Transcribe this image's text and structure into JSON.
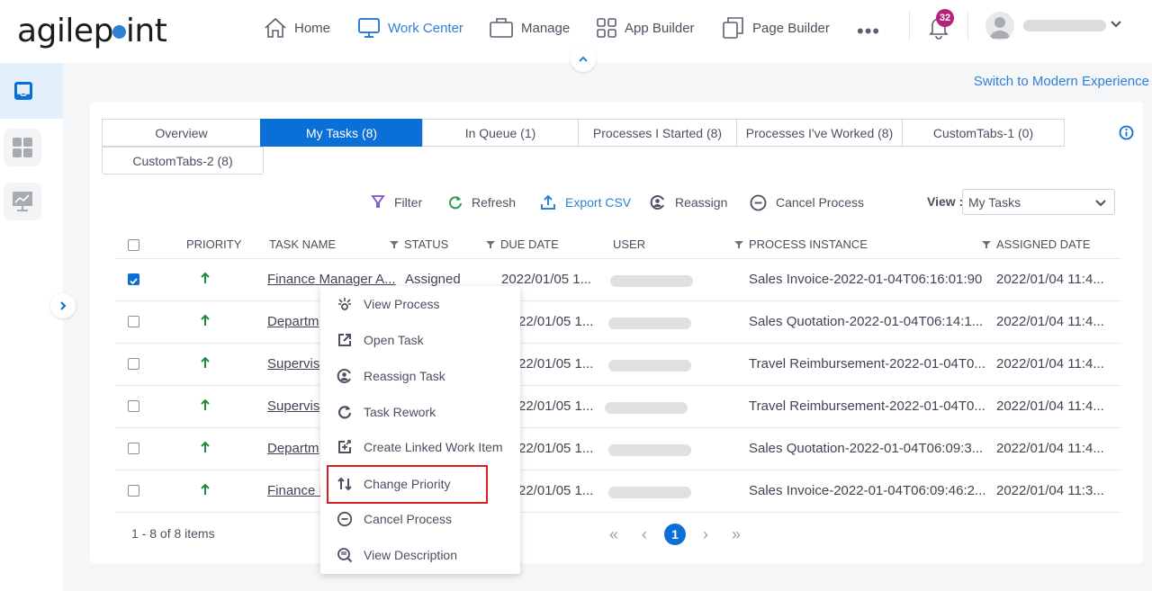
{
  "brand": {
    "logo_text_a": "agilep",
    "logo_text_b": "int",
    "accent": "#2f7fd6"
  },
  "nav": [
    {
      "label": "Home",
      "icon": "home-icon"
    },
    {
      "label": "Work Center",
      "icon": "monitor-icon",
      "active": true
    },
    {
      "label": "Manage",
      "icon": "briefcase-icon"
    },
    {
      "label": "App Builder",
      "icon": "grid-icon"
    },
    {
      "label": "Page Builder",
      "icon": "pages-icon"
    }
  ],
  "more_label": "•••",
  "notifications": {
    "count": "32"
  },
  "switch_link": "Switch to Modern Experience",
  "tabs": [
    {
      "label": "Overview"
    },
    {
      "label": "My Tasks (8)",
      "active": true
    },
    {
      "label": "In Queue (1)"
    },
    {
      "label": "Processes I Started (8)"
    },
    {
      "label": "Processes I've Worked (8)"
    },
    {
      "label": "CustomTabs-1 (0)"
    },
    {
      "label": "CustomTabs-2 (8)"
    }
  ],
  "toolbar": {
    "filter": "Filter",
    "refresh": "Refresh",
    "export": "Export CSV",
    "reassign": "Reassign",
    "cancel": "Cancel Process",
    "view_label": "View :",
    "view_value": "My Tasks"
  },
  "table": {
    "headers": {
      "priority": "PRIORITY",
      "task_name": "TASK NAME",
      "status": "STATUS",
      "due_date": "DUE DATE",
      "user": "USER",
      "process_instance": "PROCESS INSTANCE",
      "assigned_date": "ASSIGNED DATE"
    },
    "rows": [
      {
        "checked": true,
        "task": "Finance Manager A...",
        "status": "Assigned",
        "due": "2022/01/05 1...",
        "process": "Sales Invoice-2022-01-04T06:16:01:90",
        "assigned": "2022/01/04 11:4..."
      },
      {
        "checked": false,
        "task": "Departm",
        "status": "",
        "due": "22/01/05 1...",
        "process": "Sales Quotation-2022-01-04T06:14:1...",
        "assigned": "2022/01/04 11:4..."
      },
      {
        "checked": false,
        "task": "Supervis",
        "status": "",
        "due": "22/01/05 1...",
        "process": "Travel Reimbursement-2022-01-04T0...",
        "assigned": "2022/01/04 11:4..."
      },
      {
        "checked": false,
        "task": "Supervis",
        "status": "",
        "due": "22/01/05 1...",
        "process": "Travel Reimbursement-2022-01-04T0...",
        "assigned": "2022/01/04 11:4..."
      },
      {
        "checked": false,
        "task": "Departm",
        "status": "",
        "due": "22/01/05 1...",
        "process": "Sales Quotation-2022-01-04T06:09:3...",
        "assigned": "2022/01/04 11:4..."
      },
      {
        "checked": false,
        "task": "Finance I",
        "status": "",
        "due": "22/01/05 1...",
        "process": "Sales Invoice-2022-01-04T06:09:46:2...",
        "assigned": "2022/01/04 11:3..."
      }
    ]
  },
  "pager": {
    "info": "1 - 8 of 8 items",
    "current": "1",
    "first": "«",
    "prev": "‹",
    "next": "›",
    "last": "»"
  },
  "context_menu": [
    {
      "label": "View Process",
      "icon": "view-process-icon"
    },
    {
      "label": "Open Task",
      "icon": "open-task-icon"
    },
    {
      "label": "Reassign Task",
      "icon": "reassign-icon"
    },
    {
      "label": "Task Rework",
      "icon": "rework-icon"
    },
    {
      "label": "Create Linked Work Item",
      "icon": "linked-item-icon"
    },
    {
      "label": "Change Priority",
      "icon": "sort-arrows-icon",
      "highlighted": true
    },
    {
      "label": "Cancel Process",
      "icon": "cancel-icon"
    },
    {
      "label": "View Description",
      "icon": "zoom-in-icon"
    }
  ]
}
